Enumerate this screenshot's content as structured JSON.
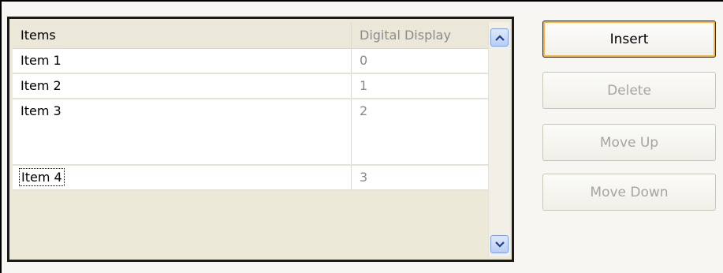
{
  "list": {
    "columns": [
      "Items",
      "Digital Display"
    ],
    "rows": [
      {
        "item": "Item 1",
        "value": "0"
      },
      {
        "item": "Item 2",
        "value": "1"
      },
      {
        "item": "Item 3",
        "value": "2"
      },
      {
        "item": "Item 4",
        "value": "3"
      }
    ]
  },
  "buttons": {
    "insert": "Insert",
    "delete": "Delete",
    "move_up": "Move Up",
    "move_down": "Move Down"
  },
  "icons": {
    "scroll_up": "chevron-up-icon",
    "scroll_down": "chevron-down-icon"
  }
}
